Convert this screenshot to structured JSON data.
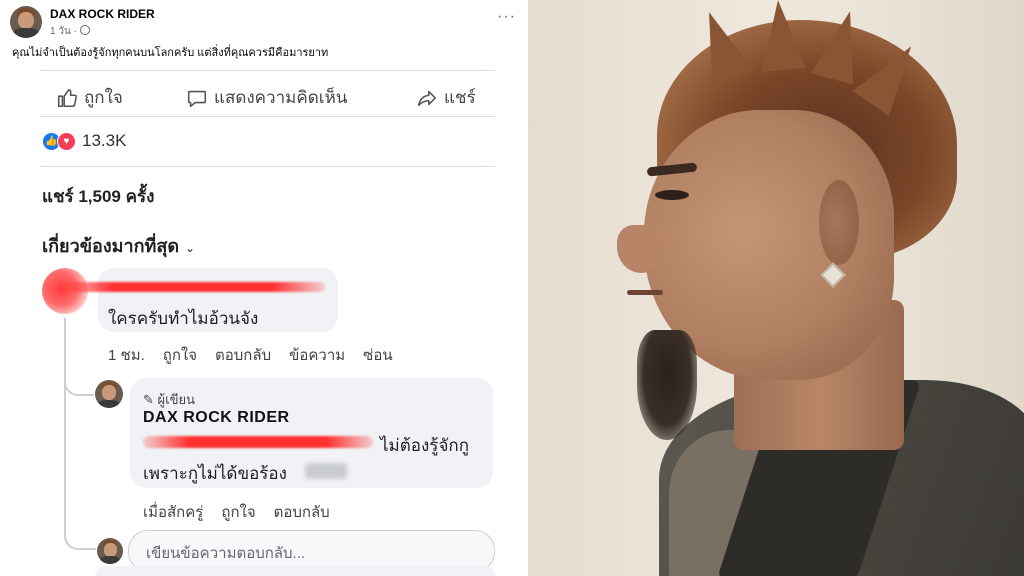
{
  "post": {
    "page_name": "DAX ROCK RIDER",
    "time": "1 วัน ·",
    "caption": "คุณไม่จำเป็นต้องรู้จักทุกคนบนโลกครับ แต่สิ่งที่คุณควรมีคือมารยาท",
    "more": "···"
  },
  "actions": {
    "like": "ถูกใจ",
    "comment": "แสดงความคิดเห็น",
    "share": "แชร์"
  },
  "reactions": {
    "count": "13.3K",
    "like_glyph": "👍",
    "love_glyph": "♥"
  },
  "share_count": "แชร์ 1,509 ครั้ง",
  "relevance": {
    "label": "เกี่ยวข้องมากที่สุด",
    "chevron": "⌄"
  },
  "comment1": {
    "text": "ใครครับทำไมอ้วนจัง",
    "meta": [
      "1 ชม.",
      "ถูกใจ",
      "ตอบกลับ",
      "ข้อความ",
      "ซ่อน"
    ]
  },
  "reply": {
    "badge": "✎ ผู้เขียน",
    "author": "DAX ROCK  RIDER",
    "line1": "ไม่ต้องรู้จักกู",
    "line2": "เพราะกูไม่ได้ขอร้อง",
    "meta": [
      "เมื่อสักครู่",
      "ถูกใจ",
      "ตอบกลับ"
    ]
  },
  "reply_input": {
    "placeholder": "เขียนข้อความตอบกลับ..."
  },
  "colors": {
    "facebook_blue": "#1877f2",
    "love_red": "#f33e58",
    "redaction_red": "#ff3030",
    "bubble": "#f0f2f5"
  }
}
